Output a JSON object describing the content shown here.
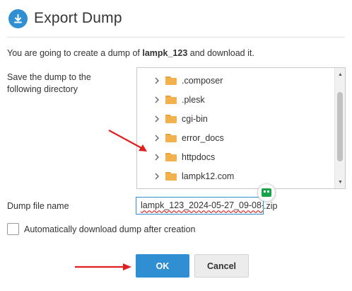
{
  "dialog": {
    "title": "Export Dump",
    "header_icon": "download-icon",
    "intro_prefix": "You are going to create a dump of ",
    "database": "lampk_123",
    "intro_suffix": " and download it."
  },
  "directory": {
    "label": "Save the dump to the following directory",
    "items": [
      {
        "name": ".composer",
        "icon": "folder-icon"
      },
      {
        "name": ".plesk",
        "icon": "folder-icon"
      },
      {
        "name": "cgi-bin",
        "icon": "folder-icon"
      },
      {
        "name": "error_docs",
        "icon": "folder-icon"
      },
      {
        "name": "httpdocs",
        "icon": "folder-icon"
      },
      {
        "name": "lampk12.com",
        "icon": "folder-icon"
      }
    ]
  },
  "dump_file": {
    "label": "Dump file name",
    "value": "lampk_123_2024-05-27_09-08-",
    "extension": ".zip"
  },
  "auto_download": {
    "label": "Automatically download dump after creation",
    "checked": false
  },
  "buttons": {
    "ok": "OK",
    "cancel": "Cancel"
  },
  "colors": {
    "accent": "#2f8fd2",
    "folder": "#f2b14c",
    "annotation_arrow": "#e02020"
  }
}
